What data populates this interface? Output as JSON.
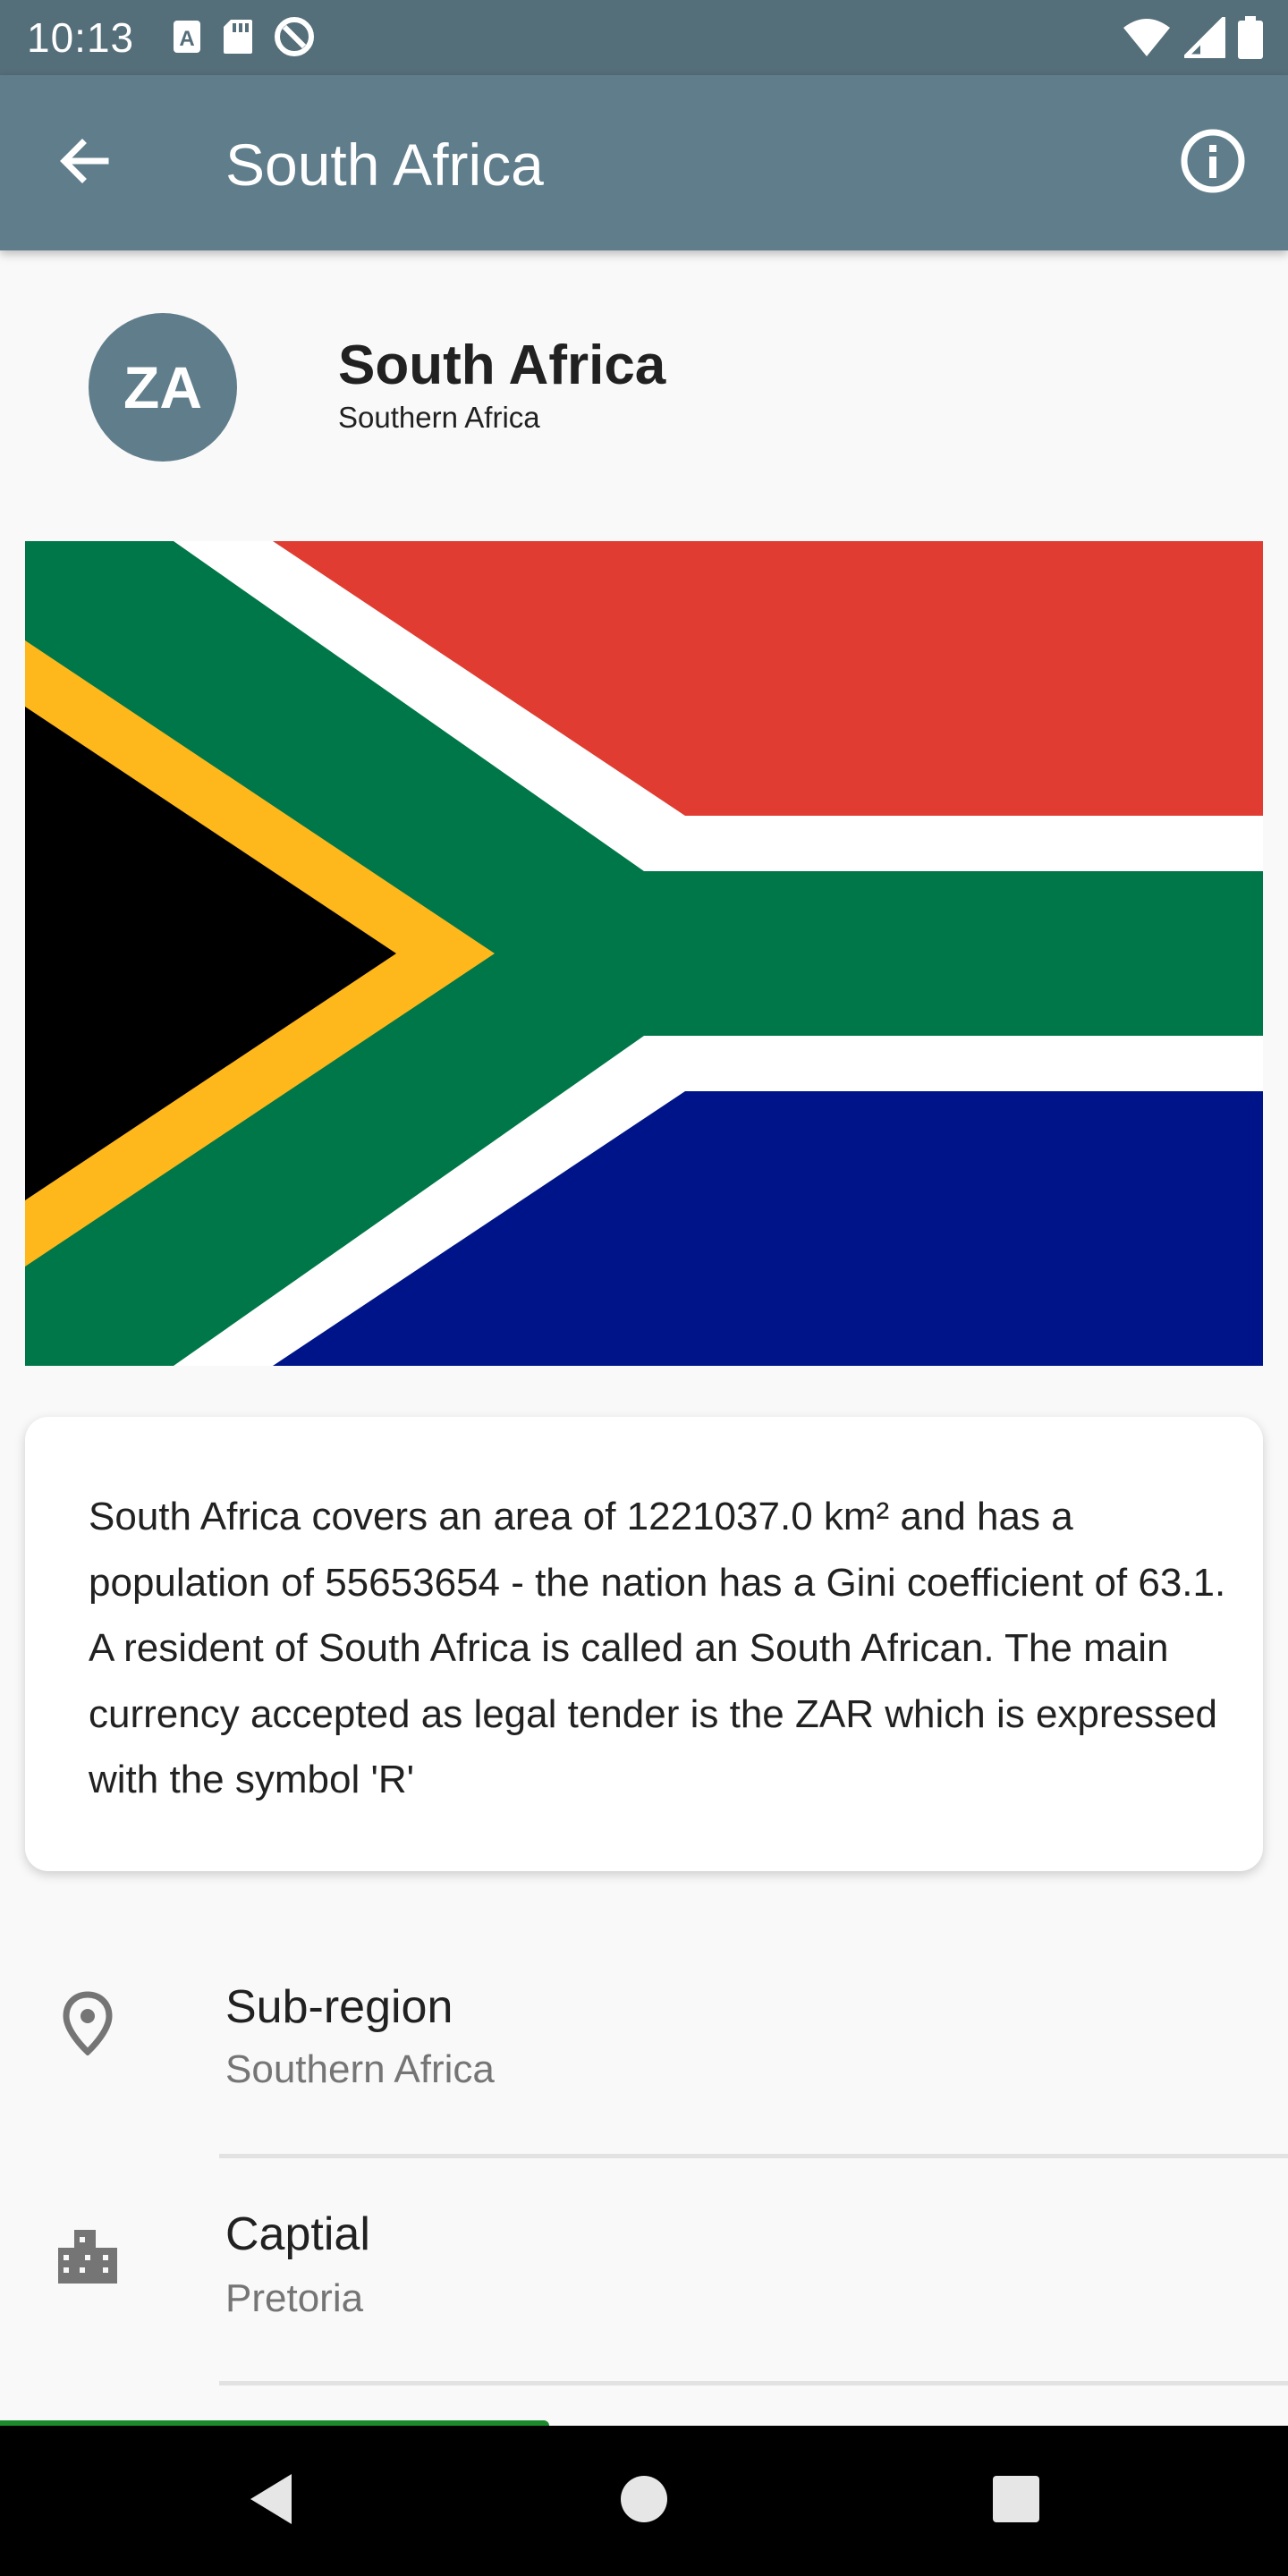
{
  "status_bar": {
    "time": "10:13",
    "left_icons": [
      "text-notification-icon",
      "sd-card-icon",
      "do-not-disturb-icon"
    ],
    "right_icons": [
      "wifi-icon",
      "cellular-signal-icon",
      "battery-icon"
    ]
  },
  "app_bar": {
    "title": "South Africa",
    "back_icon": "arrow-back-icon",
    "info_icon": "info-icon"
  },
  "header": {
    "avatar_text": "ZA",
    "name": "South Africa",
    "region": "Southern Africa"
  },
  "flag": {
    "colors": {
      "red": "#e03c31",
      "white": "#ffffff",
      "green": "#007749",
      "blue": "#001489",
      "gold": "#ffb81c",
      "black": "#000000"
    }
  },
  "description": "South Africa covers an area of 1221037.0 km² and has a population of 55653654 - the nation has a Gini coefficient of 63.1. A resident of South Africa is called an South African. The main currency accepted as legal tender is the ZAR which is expressed with the symbol 'R'",
  "info_list": [
    {
      "icon": "location-pin-icon",
      "title": "Sub-region",
      "value": "Southern Africa"
    },
    {
      "icon": "city-icon",
      "title": "Captial",
      "value": "Pretoria"
    }
  ],
  "nav_bar": {
    "buttons": [
      "back-triangle-icon",
      "home-circle-icon",
      "recents-square-icon"
    ]
  },
  "colors": {
    "primary": "#607d8b",
    "primary_dark": "#546e7a",
    "background": "#f9f9f9"
  }
}
